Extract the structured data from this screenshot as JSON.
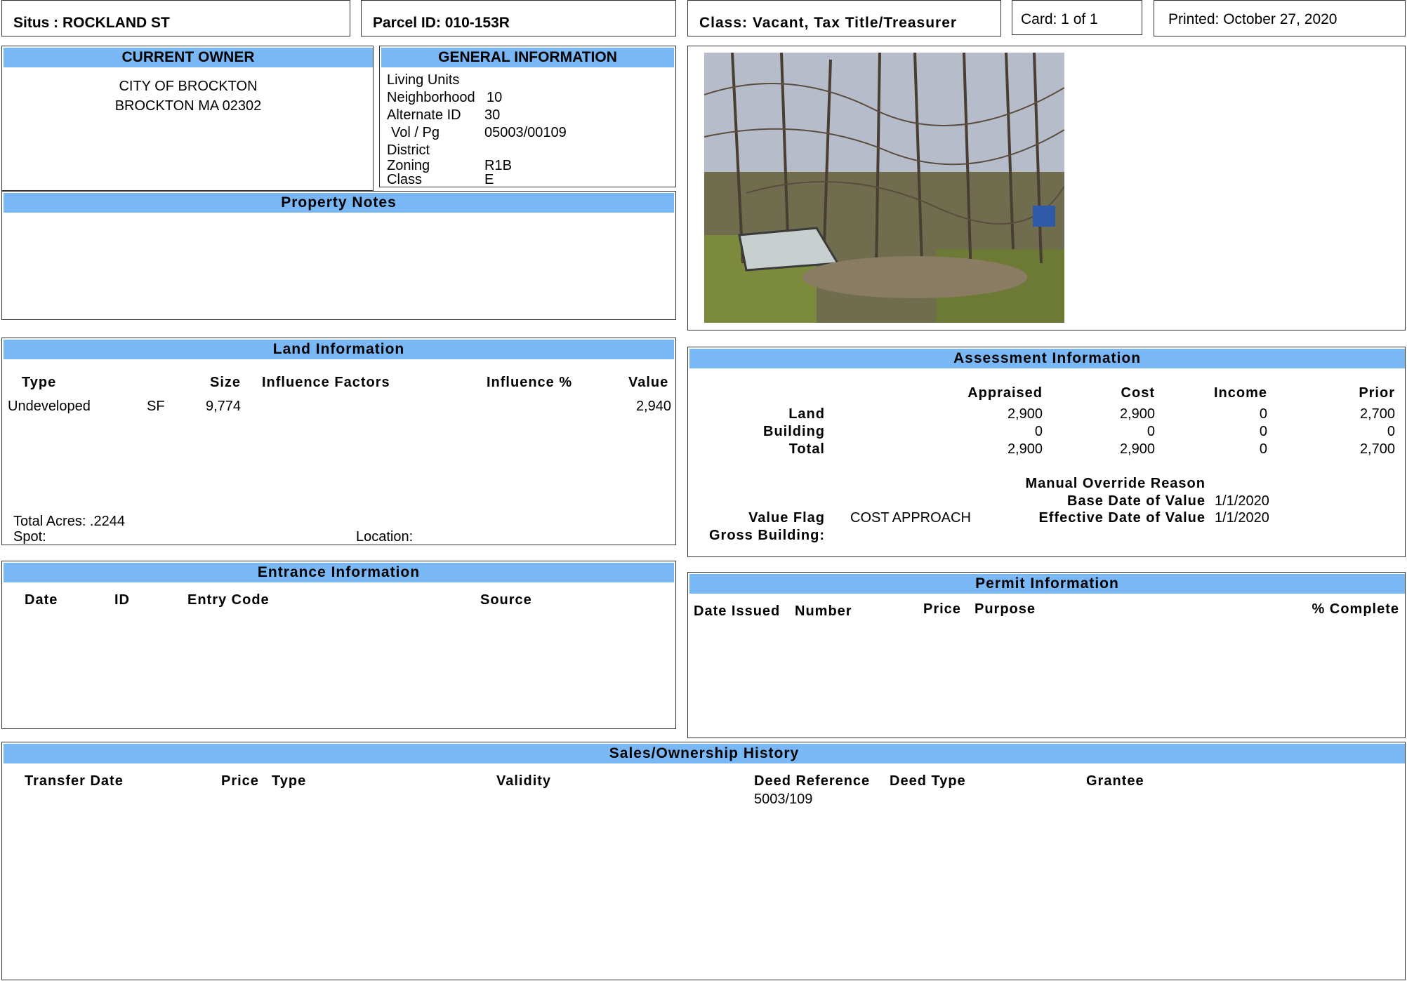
{
  "header": {
    "situs": "Situs : ROCKLAND ST",
    "parcel": "Parcel ID: 010-153R",
    "class": "Class: Vacant, Tax Title/Treasurer",
    "card": "Card: 1 of 1",
    "printed": "Printed: October 27, 2020"
  },
  "owner": {
    "title": "CURRENT OWNER",
    "line1": "CITY OF BROCKTON",
    "line2": "BROCKTON MA 02302"
  },
  "general": {
    "title": "GENERAL INFORMATION",
    "rows": [
      {
        "label": "Living Units",
        "value": ""
      },
      {
        "label": "Neighborhood",
        "value": "10"
      },
      {
        "label": "Alternate ID",
        "value": "30"
      },
      {
        "label": "Vol / Pg",
        "value": "05003/00109"
      },
      {
        "label": "District",
        "value": ""
      },
      {
        "label": "Zoning",
        "value": "R1B"
      },
      {
        "label": "Class",
        "value": "E"
      }
    ]
  },
  "notes": {
    "title": "Property Notes"
  },
  "land": {
    "title": "Land Information",
    "headers": {
      "type": "Type",
      "size": "Size",
      "influence_factors": "Influence Factors",
      "influence_pct": "Influence %",
      "value": "Value"
    },
    "rows": [
      {
        "type": "Undeveloped",
        "unit": "SF",
        "size": "9,774",
        "value": "2,940"
      }
    ],
    "total_acres": "Total Acres: .2244",
    "spot": "Spot:",
    "location": "Location:"
  },
  "assessment": {
    "title": "Assessment Information",
    "columns": [
      "Appraised",
      "Cost",
      "Income",
      "Prior"
    ],
    "rows": [
      {
        "label": "Land",
        "values": [
          "2,900",
          "2,900",
          "0",
          "2,700"
        ]
      },
      {
        "label": "Building",
        "values": [
          "0",
          "0",
          "0",
          "0"
        ]
      },
      {
        "label": "Total",
        "values": [
          "2,900",
          "2,900",
          "0",
          "2,700"
        ]
      }
    ],
    "manual_override": "Manual Override Reason",
    "base_date_label": "Base Date of Value",
    "base_date": "1/1/2020",
    "effective_date_label": "Effective Date of Value",
    "effective_date": "1/1/2020",
    "value_flag_label": "Value Flag",
    "value_flag": "COST APPROACH",
    "gross_building_label": "Gross Building:"
  },
  "entrance": {
    "title": "Entrance Information",
    "headers": {
      "date": "Date",
      "id": "ID",
      "entry_code": "Entry Code",
      "source": "Source"
    }
  },
  "permit": {
    "title": "Permit Information",
    "headers": {
      "date_issued": "Date Issued",
      "number": "Number",
      "price": "Price",
      "purpose": "Purpose",
      "complete": "% Complete"
    }
  },
  "sales": {
    "title": "Sales/Ownership History",
    "headers": {
      "transfer_date": "Transfer Date",
      "price": "Price",
      "type": "Type",
      "validity": "Validity",
      "deed_reference": "Deed Reference",
      "deed_type": "Deed Type",
      "grantee": "Grantee"
    },
    "rows": [
      {
        "deed_reference": "5003/109"
      }
    ]
  },
  "colors": {
    "header_bar": "#7ab8f5",
    "border": "#333333"
  }
}
